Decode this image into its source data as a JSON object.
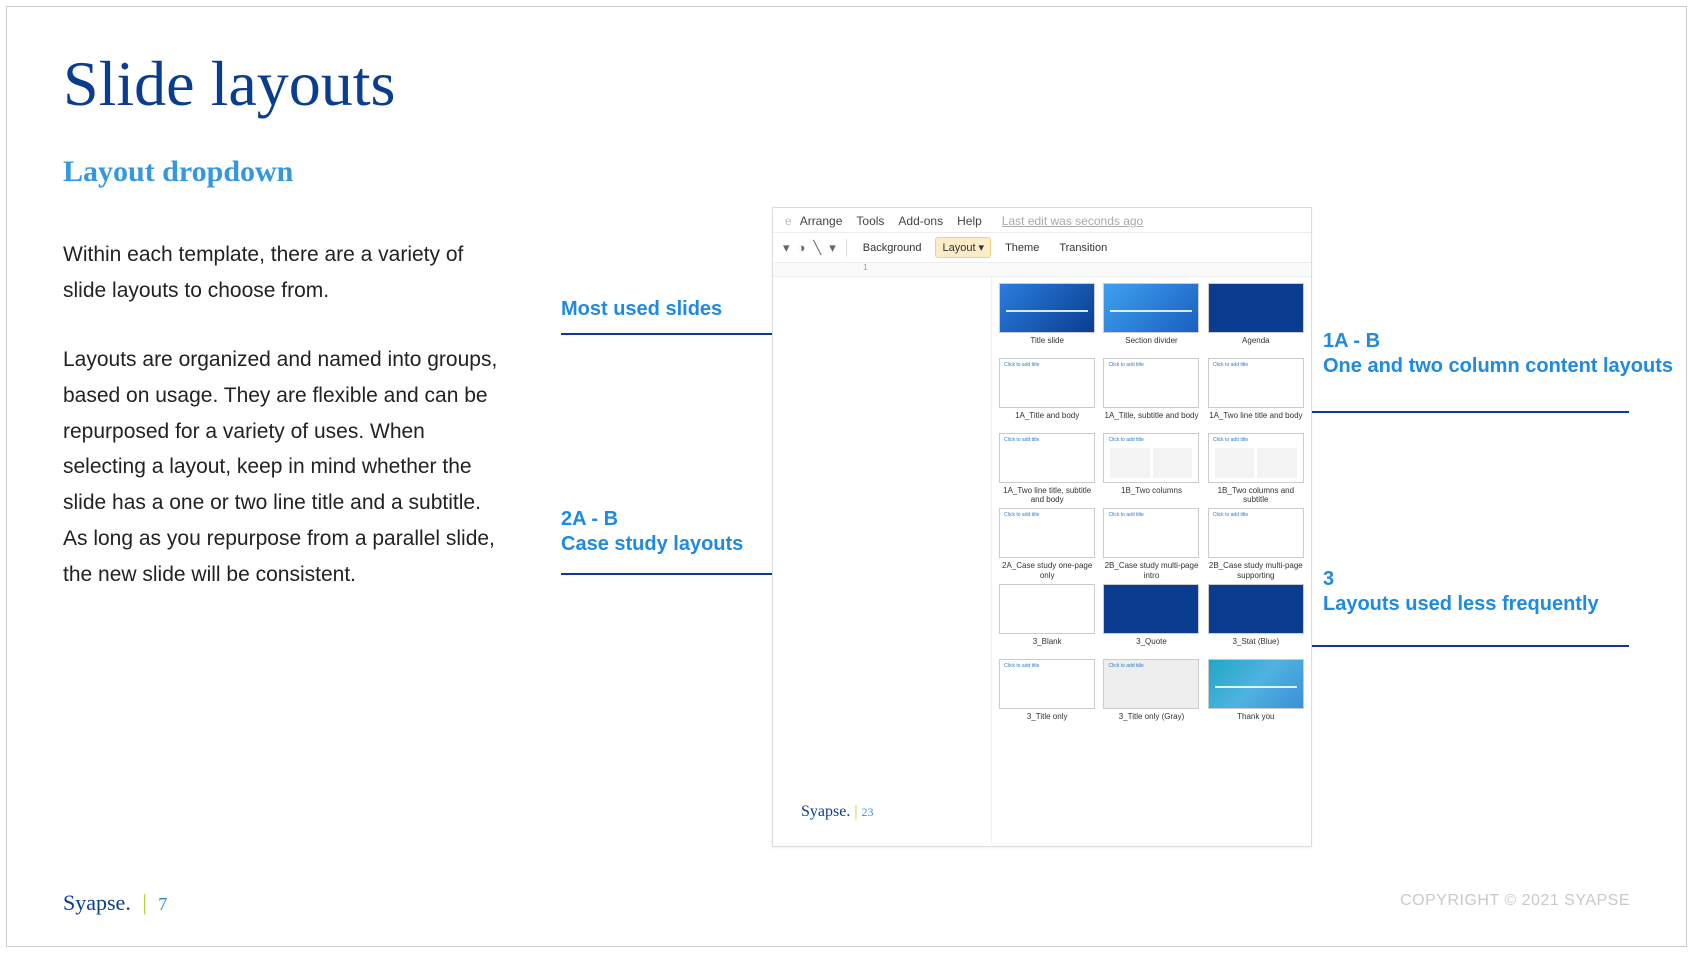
{
  "title": "Slide layouts",
  "subtitle": "Layout dropdown",
  "body": {
    "p1": "Within each template, there are a variety of slide layouts to choose from.",
    "p2": "Layouts are organized and named into groups, based on usage. They are flexible and can be repurposed for a variety of uses. When selecting a layout, keep in mind whether the slide has a one or two line title and a subtitle. As long as you repurpose from a parallel slide, the new slide will be consistent."
  },
  "callouts": {
    "left1": "Most used slides",
    "left2_title": "2A - B",
    "left2_sub": "Case study layouts",
    "right1_title": "1A - B",
    "right1_sub": "One and two column content layouts",
    "right2_title": "3",
    "right2_sub": "Layouts used less frequently"
  },
  "app": {
    "menu": [
      "Arrange",
      "Tools",
      "Add-ons",
      "Help"
    ],
    "edit_status": "Last edit was seconds ago",
    "toolbar": {
      "background": "Background",
      "layout": "Layout",
      "theme": "Theme",
      "transition": "Transition"
    },
    "ruler_mark": "1",
    "mini_brand": "Syapse.",
    "mini_page": "23",
    "layouts": [
      {
        "label": "Title slide",
        "style": "blue"
      },
      {
        "label": "Section divider",
        "style": "blue2"
      },
      {
        "label": "Agenda",
        "style": "solidblue"
      },
      {
        "label": "1A_Title and body",
        "style": "plain"
      },
      {
        "label": "1A_Title, subtitle and body",
        "style": "plain"
      },
      {
        "label": "1A_Two line title and body",
        "style": "plain"
      },
      {
        "label": "1A_Two line title, subtitle and body",
        "style": "plain"
      },
      {
        "label": "1B_Two columns",
        "style": "twocol"
      },
      {
        "label": "1B_Two columns and subtitle",
        "style": "twocol"
      },
      {
        "label": "2A_Case study one-page only",
        "style": "plain"
      },
      {
        "label": "2B_Case study multi-page intro",
        "style": "plain"
      },
      {
        "label": "2B_Case study multi-page supporting",
        "style": "plain"
      },
      {
        "label": "3_Blank",
        "style": "blank"
      },
      {
        "label": "3_Quote",
        "style": "solidblue"
      },
      {
        "label": "3_Stat (Blue)",
        "style": "solidblue"
      },
      {
        "label": "3_Title only",
        "style": "plain"
      },
      {
        "label": "3_Title only (Gray)",
        "style": "gray"
      },
      {
        "label": "Thank you",
        "style": "teal"
      }
    ]
  },
  "footer": {
    "brand": "Syapse.",
    "page": "7"
  },
  "copyright": "COPYRIGHT © 2021 SYAPSE"
}
